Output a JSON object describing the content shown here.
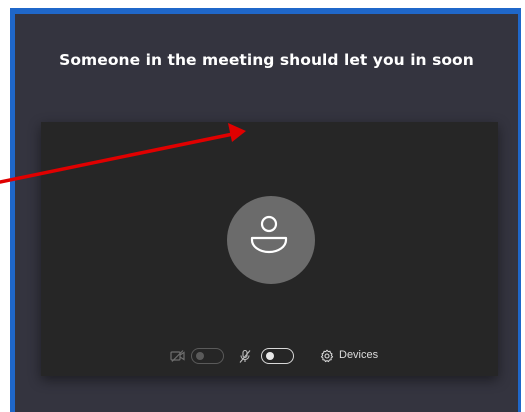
{
  "lobby": {
    "title": "Someone in the meeting should let you in soon"
  },
  "preview": {
    "avatar_icon": "person-icon"
  },
  "controls": {
    "camera": {
      "icon": "video-off-icon",
      "enabled": false
    },
    "microphone": {
      "icon": "mic-off-icon",
      "enabled": false
    },
    "devices": {
      "icon": "gear-icon",
      "label": "Devices"
    }
  },
  "colors": {
    "frame_border": "#1f67c9",
    "lobby_background": "#34343f",
    "preview_background": "#262626",
    "avatar_background": "#6b6b6b",
    "annotation_arrow": "#e00000"
  }
}
